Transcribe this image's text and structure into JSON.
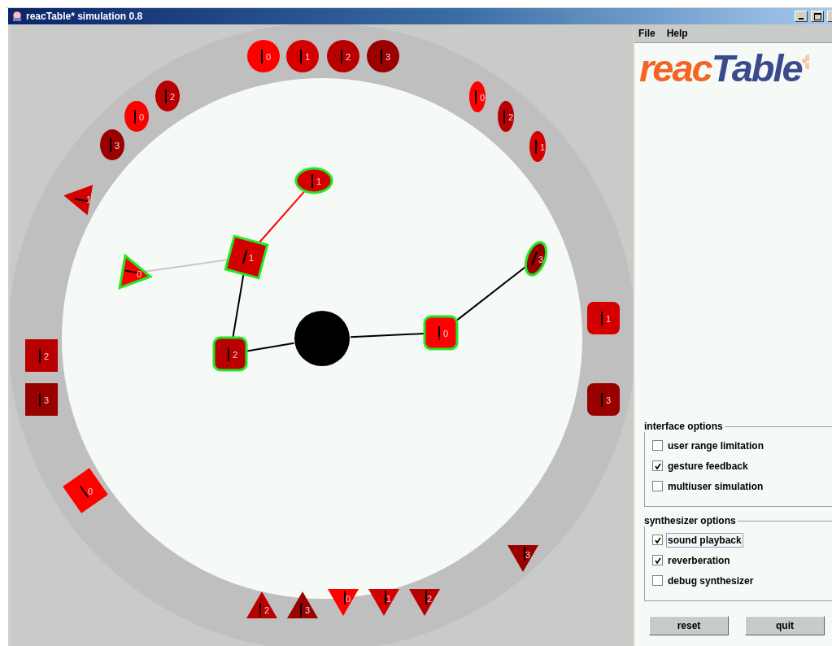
{
  "window": {
    "title": "reacTable* simulation 0.8"
  },
  "table": {
    "tokens": [
      {
        "kind": "circle",
        "label": "0",
        "color": "#ff0000",
        "active": false
      },
      {
        "kind": "circle",
        "label": "1",
        "color": "#d40000",
        "active": false
      },
      {
        "kind": "circle",
        "label": "2",
        "color": "#b80000",
        "active": false
      },
      {
        "kind": "circle",
        "label": "3",
        "color": "#990000",
        "active": false
      },
      {
        "kind": "circle",
        "label": "2",
        "color": "#b80000",
        "active": false
      },
      {
        "kind": "circle",
        "label": "0",
        "color": "#ff0000",
        "active": false
      },
      {
        "kind": "circle",
        "label": "3",
        "color": "#990000",
        "active": false
      },
      {
        "kind": "circle",
        "label": "0",
        "color": "#ff0000",
        "active": false
      },
      {
        "kind": "circle",
        "label": "2",
        "color": "#b80000",
        "active": false
      },
      {
        "kind": "circle",
        "label": "1",
        "color": "#d40000",
        "active": false
      },
      {
        "kind": "triangle",
        "label": "1",
        "color": "#d40000",
        "active": false
      },
      {
        "kind": "triangle",
        "label": "0",
        "color": "#ff0000",
        "active": true
      },
      {
        "kind": "square",
        "label": "1",
        "color": "#d40000",
        "active": true
      },
      {
        "kind": "circle",
        "label": "1",
        "color": "#d40000",
        "active": true
      },
      {
        "kind": "circle",
        "label": "3",
        "color": "#990000",
        "active": true
      },
      {
        "kind": "rounded",
        "label": "2",
        "color": "#b80000",
        "active": true
      },
      {
        "kind": "rounded",
        "label": "0",
        "color": "#ff0000",
        "active": true
      },
      {
        "kind": "hub",
        "color": "#000000",
        "active": false
      },
      {
        "kind": "rounded",
        "label": "1",
        "color": "#d40000",
        "active": false
      },
      {
        "kind": "rounded",
        "label": "3",
        "color": "#990000",
        "active": false
      },
      {
        "kind": "square",
        "label": "2",
        "color": "#b80000",
        "active": false
      },
      {
        "kind": "square",
        "label": "3",
        "color": "#990000",
        "active": false
      },
      {
        "kind": "square",
        "label": "0",
        "color": "#ff0000",
        "active": false
      },
      {
        "kind": "triangle",
        "label": "3",
        "color": "#990000",
        "active": false
      },
      {
        "kind": "triangle",
        "label": "2",
        "color": "#b80000",
        "active": false
      },
      {
        "kind": "triangle",
        "label": "3",
        "color": "#990000",
        "active": false
      },
      {
        "kind": "triangle",
        "label": "0",
        "color": "#ff0000",
        "active": false
      },
      {
        "kind": "triangle",
        "label": "1",
        "color": "#d40000",
        "active": false
      },
      {
        "kind": "triangle",
        "label": "2",
        "color": "#b80000",
        "active": false
      }
    ],
    "links": [
      {
        "color": "#ff0000"
      },
      {
        "color": "#c8c8c8"
      },
      {
        "color": "#000000"
      },
      {
        "color": "#000000"
      },
      {
        "color": "#000000"
      },
      {
        "color": "#000000"
      }
    ]
  },
  "menu": [
    "File",
    "Help"
  ],
  "logo": {
    "parts": [
      {
        "text": "reac",
        "color": "#f26522"
      },
      {
        "text": "Table",
        "color": "#3b4a8c"
      }
    ]
  },
  "option_groups": [
    {
      "title": "interface options",
      "options": [
        {
          "label": "user range limitation",
          "checked": false,
          "focused": false
        },
        {
          "label": "gesture feedback",
          "checked": true,
          "focused": false
        },
        {
          "label": "multiuser simulation",
          "checked": false,
          "focused": false
        }
      ]
    },
    {
      "title": "synthesizer options",
      "options": [
        {
          "label": "sound playback",
          "checked": true,
          "focused": true
        },
        {
          "label": "reverberation",
          "checked": true,
          "focused": false
        },
        {
          "label": "debug synthesizer",
          "checked": false,
          "focused": false
        }
      ]
    }
  ],
  "buttons": [
    "reset",
    "quit"
  ]
}
